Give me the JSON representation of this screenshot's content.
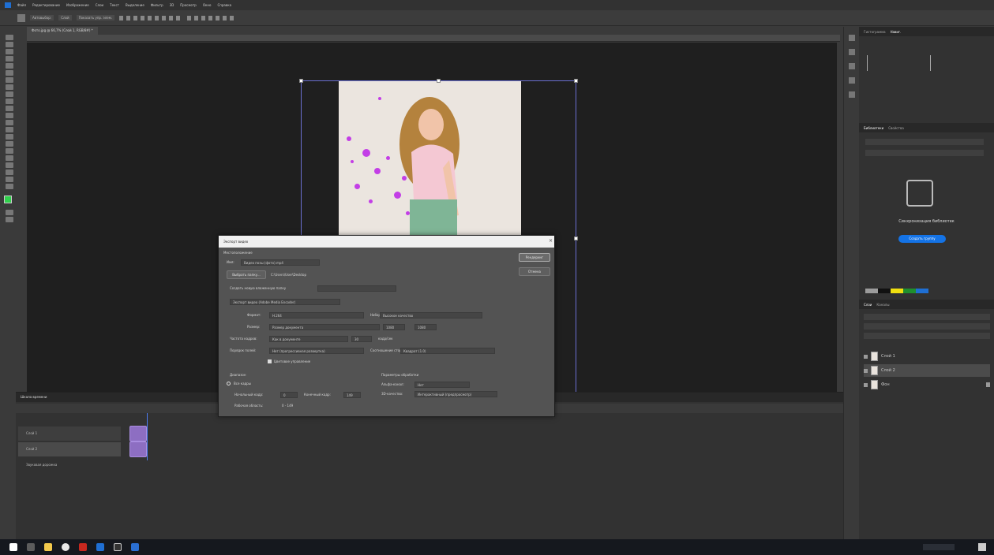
{
  "app": {
    "menu": [
      "Файл",
      "Редактирование",
      "Изображение",
      "Слои",
      "Текст",
      "Выделение",
      "Фильтр",
      "3D",
      "Просмотр",
      "Окно",
      "Справка"
    ],
    "document_tab": "Фото.jpg @ 66,7% (Слой 1, RGB/8#) *"
  },
  "options": {
    "items": [
      "Автовыбор:",
      "Слой",
      "Показать упр. элем."
    ]
  },
  "right_panel": {
    "top_tabs": [
      "Гистограмма",
      "Навиг."
    ],
    "libs_tabs": [
      "Библиотеки",
      "Свойства"
    ],
    "libs_heading": "Синхронизация библиотек",
    "libs_button": "Создать группу",
    "layers_tabs": [
      "Слои",
      "Каналы"
    ],
    "layers": [
      {
        "name": "Слой 1"
      },
      {
        "name": "Слой 2"
      },
      {
        "name": "Фон"
      }
    ],
    "colors": [
      "#9c9c9c",
      "#111111",
      "#f1e010",
      "#1f8f2f",
      "#1f6fd3"
    ]
  },
  "timeline": {
    "title": "Шкала времени",
    "tracks": [
      "Слой 1",
      "Слой 2",
      "Звуковая дорожка"
    ]
  },
  "dialog": {
    "title": "Экспорт видео",
    "section_render": "Местоположение",
    "name_label": "Имя:",
    "name_value": "Видео позы (фото).mp4",
    "folder_button": "Выбрать папку...",
    "folder_path": "C:\\Users\\User\\Desktop",
    "subfolder_label": "Создать новую вложенную папку",
    "export_label": "Экспорт видео (Adobe Media Encoder)",
    "format_label": "Формат:",
    "format_value": "H.264",
    "preset_label": "Набор:",
    "preset_value": "Высокое качество",
    "size_label": "Размер:",
    "size_value": "Размер документа",
    "width_value": "1080",
    "height_value": "1080",
    "fps_label": "Частота кадров:",
    "fps_value": "Как в документе",
    "fps_num": "30",
    "fps_unit": "кадр/сек",
    "aspect_label": "Соотношение сторон:",
    "aspect_value": "Квадрат (1.0)",
    "order_label": "Порядок полей:",
    "order_value": "Нет (прогрессивная развертка)",
    "color_label": "Цветовое управление",
    "range_section": "Диапазон",
    "all_frames": "Все кадры",
    "start_label": "Начальный кадр:",
    "start_value": "0",
    "end_label": "Конечный кадр:",
    "end_value": "149",
    "work_label": "Рабочая область:",
    "work_value": "0 - 149",
    "render_section": "Параметры обработки",
    "alpha_label": "Альфа-канал:",
    "alpha_value": "Нет",
    "interp_label": "3D-качество:",
    "interp_value": "Интерактивный (предпросмотр)",
    "ok_button": "Рендеринг",
    "cancel_button": "Отмена"
  }
}
